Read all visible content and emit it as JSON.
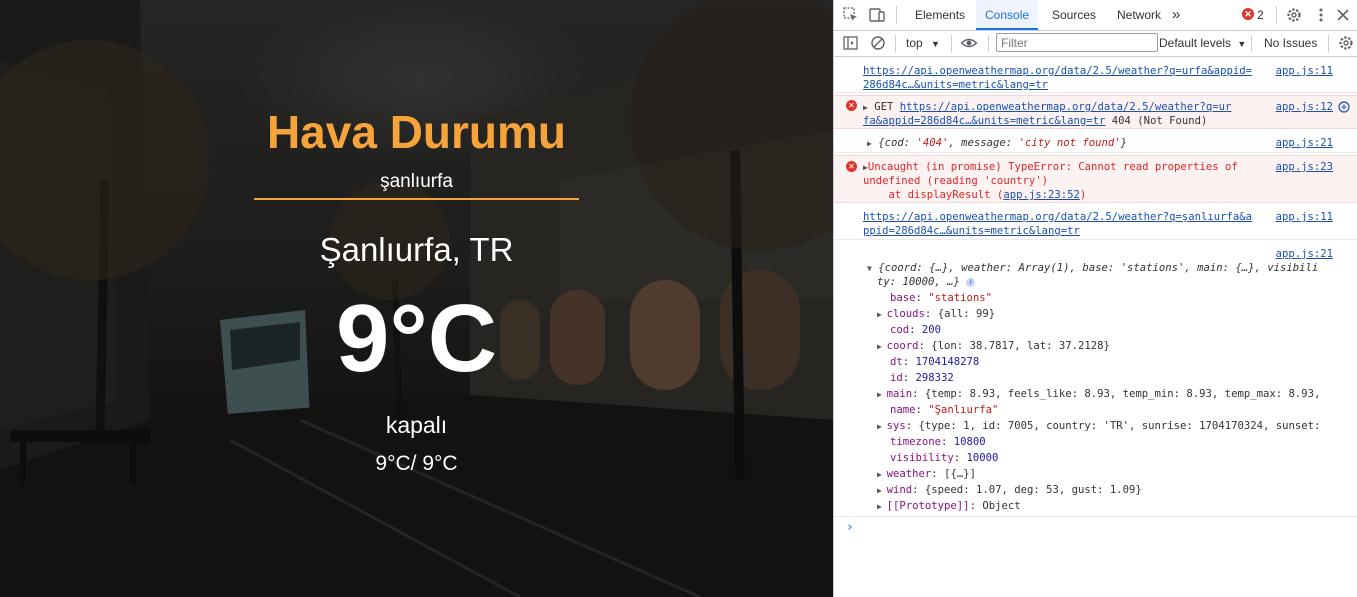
{
  "app": {
    "title": "Hava Durumu",
    "search_value": "şanlıurfa",
    "city": "Şanlıurfa, TR",
    "temp": "9°C",
    "description": "kapalı",
    "minmax": "9°C/ 9°C",
    "accent": "#f5a33a"
  },
  "devtools": {
    "tabs": [
      "Elements",
      "Console",
      "Sources",
      "Network"
    ],
    "active_tab": "Console",
    "more_tabs": "»",
    "error_count": "2",
    "toolbar": {
      "context": "top",
      "filter_placeholder": "Filter",
      "levels": "Default levels",
      "issues": "No Issues"
    },
    "messages": {
      "m1": {
        "line1": "https://api.openweathermap.org/data/2.5/weather?q=urfa&appid=",
        "line2": "286d84c…&units=metric&lang=tr",
        "src": "app.js:11"
      },
      "m2": {
        "get": "GET",
        "url1": "https://api.openweathermap.org/data/2.5/weather?q=ur",
        "url2": "fa&appid=286d84c…&units=metric&lang=tr",
        "status": " 404 (Not Found)",
        "src": "app.js:12"
      },
      "m3": {
        "text_pre": "{cod: ",
        "cod": "'404'",
        "text_mid": ", message: ",
        "message": "'city not found'",
        "text_post": "}",
        "src": "app.js:21"
      },
      "m4": {
        "line1": "Uncaught (in promise) TypeError: Cannot read properties of",
        "line2": "undefined (reading 'country')",
        "line3_pre": "    at displayResult (",
        "line3_link": "app.js:23:52",
        "line3_post": ")",
        "src": "app.js:23"
      },
      "m5": {
        "line1": "https://api.openweathermap.org/data/2.5/weather?q=şanlıurfa&a",
        "line2": "ppid=286d84c…&units=metric&lang=tr",
        "src": "app.js:11"
      },
      "m6": {
        "src": "app.js:21",
        "summary1": "{coord: {…}, weather: Array(1), base: 'stations', main: {…}, visibili",
        "summary2": "ty: 10000, …}",
        "info": "i",
        "props": [
          {
            "key": "base",
            "value": "\"stations\"",
            "expandable": false
          },
          {
            "key": "clouds",
            "value": "{all: 99}",
            "expandable": true
          },
          {
            "key": "cod",
            "value": "200",
            "expandable": false
          },
          {
            "key": "coord",
            "value": "{lon: 38.7817, lat: 37.2128}",
            "expandable": true
          },
          {
            "key": "dt",
            "value": "1704148278",
            "expandable": false
          },
          {
            "key": "id",
            "value": "298332",
            "expandable": false
          },
          {
            "key": "main",
            "value": "{temp: 8.93, feels_like: 8.93, temp_min: 8.93, temp_max: 8.93,",
            "expandable": true
          },
          {
            "key": "name",
            "value": "\"Şanlıurfa\"",
            "expandable": false
          },
          {
            "key": "sys",
            "value": "{type: 1, id: 7005, country: 'TR', sunrise: 1704170324, sunset:",
            "expandable": true
          },
          {
            "key": "timezone",
            "value": "10800",
            "expandable": false
          },
          {
            "key": "visibility",
            "value": "10000",
            "expandable": false
          },
          {
            "key": "weather",
            "value": "[{…}]",
            "expandable": true
          },
          {
            "key": "wind",
            "value": "{speed: 1.07, deg: 53, gust: 1.09}",
            "expandable": true
          },
          {
            "key": "[[Prototype]]",
            "value": "Object",
            "expandable": true
          }
        ]
      }
    },
    "prompt": "›"
  }
}
